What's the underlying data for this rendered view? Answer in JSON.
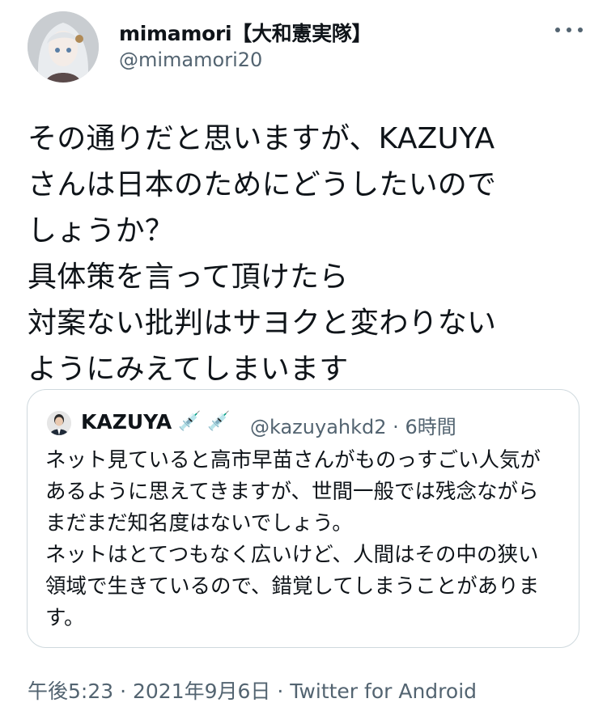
{
  "author": {
    "display_name": "mimamori【大和憲実隊】",
    "handle": "@mimamori20"
  },
  "tweet": {
    "lines": [
      "その通りだと思いますが、KAZUYA",
      "さんは日本のためにどうしたいので",
      "しょうか？",
      "具体策を言って頂けたら",
      "対案ない批判はサヨクと変わりない",
      "ようにみえてしまいます"
    ]
  },
  "quote": {
    "name": "KAZUYA",
    "emoji": "💉",
    "handle": "@kazuyahkd2",
    "separator": "·",
    "time": "6時間",
    "lines": [
      "ネット見ていると高市早苗さんがものっすごい人気が",
      "あるように思えてきますが、世間一般では残念ながら",
      "まだまだ知名度はないでしょう。",
      "ネットはとてつもなく広いけど、人間はその中の狭い",
      "領域で生きているので、錯覚してしまうことがありま",
      "す。"
    ]
  },
  "footer": {
    "time": "午後5:23",
    "sep1": "·",
    "date": "2021年9月6日",
    "sep2": "·",
    "source": "Twitter for Android"
  }
}
